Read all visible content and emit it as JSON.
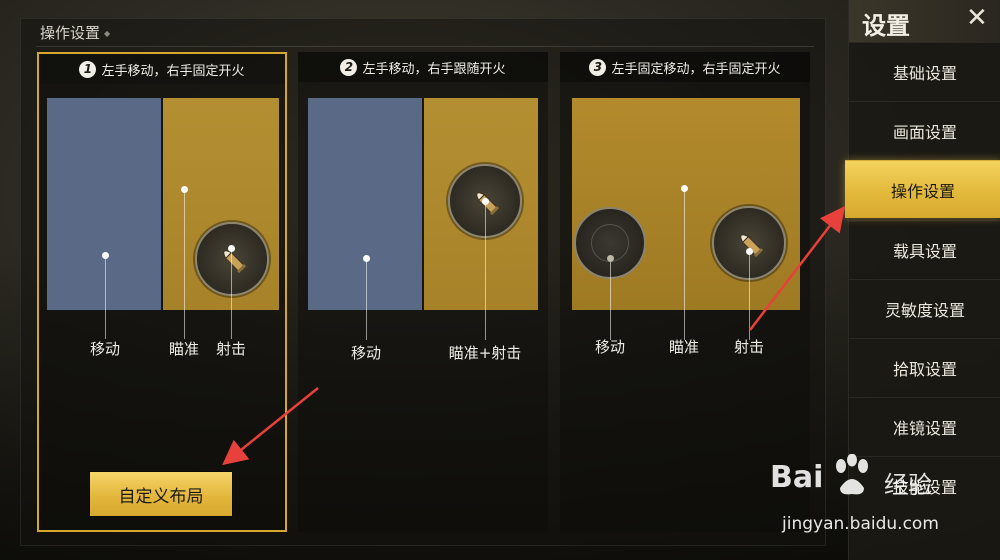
{
  "section": {
    "title": "操作设置"
  },
  "options": [
    {
      "number": "1",
      "title": "左手移动，右手固定开火",
      "selected": true,
      "labels": [
        "移动",
        "瞄准",
        "射击"
      ]
    },
    {
      "number": "2",
      "title": "左手移动，右手跟随开火",
      "selected": false,
      "labels": [
        "移动",
        "瞄准+射击"
      ]
    },
    {
      "number": "3",
      "title": "左手固定移动，右手固定开火",
      "selected": false,
      "labels": [
        "移动",
        "瞄准",
        "射击"
      ]
    }
  ],
  "custom_layout_label": "自定义布局",
  "menu": {
    "title": "设置",
    "close_icon": "close-icon",
    "items": [
      {
        "label": "基础设置",
        "active": false
      },
      {
        "label": "画面设置",
        "active": false
      },
      {
        "label": "操作设置",
        "active": true
      },
      {
        "label": "载具设置",
        "active": false
      },
      {
        "label": "灵敏度设置",
        "active": false
      },
      {
        "label": "拾取设置",
        "active": false
      },
      {
        "label": "准镜设置",
        "active": false
      },
      {
        "label": "技能设置",
        "active": false
      }
    ]
  },
  "watermark": {
    "brand": "Bai",
    "brand_suffix": "经验",
    "url": "jingyan.baidu.com"
  },
  "colors": {
    "accent_gold": "#e3b73c",
    "move_zone_blue": "#5a6a86",
    "aim_zone_gold": "#b48f32",
    "annotation_arrow": "#e8403a"
  }
}
